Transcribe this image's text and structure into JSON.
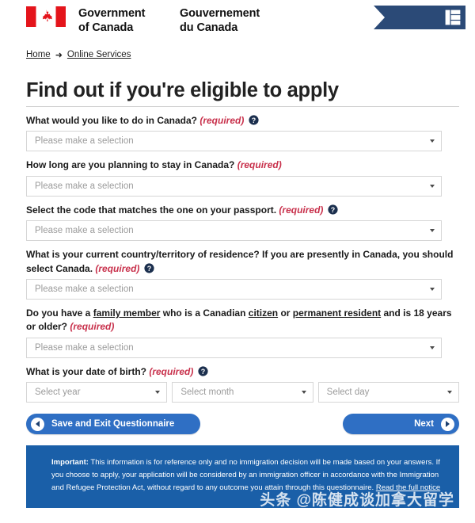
{
  "header": {
    "flag_icon": "canada-flag-icon",
    "brand_en": "Government\nof Canada",
    "brand_en_line1": "Government",
    "brand_en_line2": "of Canada",
    "brand_fr_line1": "Gouvernement",
    "brand_fr_line2": "du Canada",
    "ribbon_icon": "grid-menu-icon",
    "ribbon_color": "#2b4a77"
  },
  "breadcrumb": {
    "home": "Home",
    "arrow": "➜",
    "current": "Online Services"
  },
  "page": {
    "title": "Find out if you're eligible to apply"
  },
  "form": {
    "required_marker": "(required)",
    "help_icon": "help-circle-icon",
    "placeholder": "Please make a selection",
    "questions": [
      {
        "id": "what-to-do",
        "text": "What would you like to do in Canada?",
        "required": "(required)",
        "has_help": true,
        "value": "Please make a selection"
      },
      {
        "id": "how-long",
        "text": "How long are you planning to stay in Canada?",
        "required": "(required)",
        "has_help": false,
        "value": "Please make a selection"
      },
      {
        "id": "passport-code",
        "text": "Select the code that matches the one on your passport.",
        "required": "(required)",
        "has_help": true,
        "value": "Please make a selection"
      },
      {
        "id": "country-residence",
        "text": "What is your current country/territory of residence? If you are presently in Canada, you should select Canada.",
        "required": "(required)",
        "has_help": true,
        "value": "Please make a selection"
      },
      {
        "id": "family-member",
        "text_parts": [
          {
            "t": "Do you have a ",
            "link": false
          },
          {
            "t": "family member",
            "link": true
          },
          {
            "t": " who is a Canadian ",
            "link": false
          },
          {
            "t": "citizen",
            "link": true
          },
          {
            "t": " or ",
            "link": false
          },
          {
            "t": "permanent resident",
            "link": true
          },
          {
            "t": " and is 18 years or older?",
            "link": false
          }
        ],
        "required": "(required)",
        "has_help": false,
        "value": "Please make a selection"
      }
    ],
    "dob": {
      "label": "What is your date of birth?",
      "required": "(required)",
      "has_help": true,
      "year": "Select year",
      "month": "Select month",
      "day": "Select day"
    }
  },
  "buttons": {
    "save": "Save and Exit Questionnaire",
    "next": "Next",
    "save_icon": "arrow-left-circle-icon",
    "next_icon": "arrow-right-circle-icon",
    "color": "#2f6fc4"
  },
  "notice": {
    "label": "Important:",
    "body": " This information is for reference only and no immigration decision will be made based on your answers. If you choose to apply, your application will be considered by an immigration officer in accordance with the Immigration and Refugee Protection Act, without regard to any outcome you attain through this questionnaire. ",
    "link": "Read the full notice",
    "background": "#1a5fa8"
  },
  "watermark": {
    "text": "头条 @陈健成谈加拿大留学"
  }
}
